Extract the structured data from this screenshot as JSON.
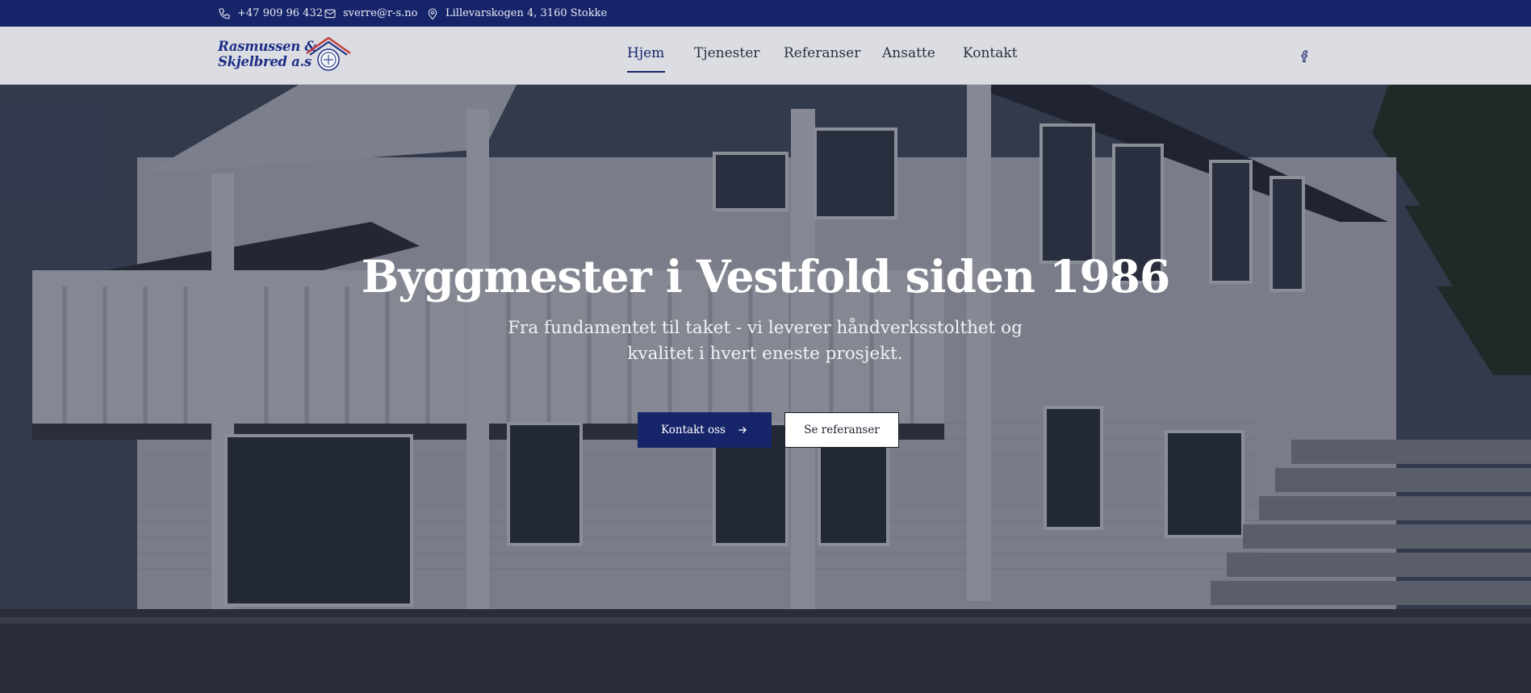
{
  "topbar": {
    "phone": "+47 909 96 432",
    "email": "sverre@r-s.no",
    "address": "Lillevarskogen 4, 3160 Stokke",
    "phone_icon": "phone-icon",
    "email_icon": "mail-icon",
    "address_icon": "map-pin-icon"
  },
  "logo": {
    "line1": "Rasmussen &",
    "line2": "Skjelbred a.s"
  },
  "nav": {
    "items": [
      {
        "label": "Hjem",
        "active": true
      },
      {
        "label": "Tjenester",
        "active": false
      },
      {
        "label": "Referanser",
        "active": false
      },
      {
        "label": "Ansatte",
        "active": false
      },
      {
        "label": "Kontakt",
        "active": false
      }
    ],
    "social_icon": "facebook-icon"
  },
  "hero": {
    "title": "Byggmester i Vestfold siden 1986",
    "subtitle": "Fra fundamentet til taket - vi leverer håndverksstolthet og kvalitet i hvert eneste prosjekt.",
    "primary_button": "Kontakt oss",
    "secondary_button": "Se referanser"
  },
  "colors": {
    "brand_navy": "#16246a",
    "nav_bg": "#e2e4e9",
    "text_light": "#ffffff"
  }
}
